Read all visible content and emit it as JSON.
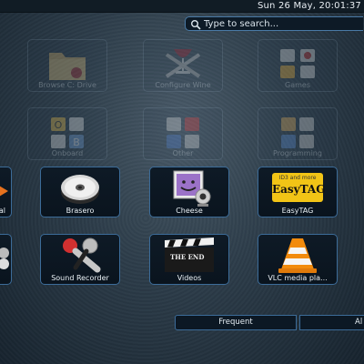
{
  "topbar": {
    "clock": "Sun 26 May, 20:01:37"
  },
  "search": {
    "placeholder": "Type to search..."
  },
  "categories_row1": [
    {
      "label": "Browse C: Drive",
      "icon": "folder-icon"
    },
    {
      "label": "Configure Wine",
      "icon": "wine-config-icon"
    },
    {
      "label": "Games",
      "icon": "games-icon"
    }
  ],
  "categories_row2": [
    {
      "label": "Onboard",
      "icon": "keyboard-icon"
    },
    {
      "label": "Other",
      "icon": "other-apps-icon"
    },
    {
      "label": "Programming",
      "icon": "programming-icon"
    }
  ],
  "apps_row1": [
    {
      "label": "al",
      "icon": "partial-app-icon"
    },
    {
      "label": "Brasero",
      "icon": "disc-burner-icon"
    },
    {
      "label": "Cheese",
      "icon": "webcam-icon"
    },
    {
      "label": "EasyTAG",
      "icon": "easytag-icon",
      "tag_lines": [
        "ID3 and more",
        "EasyTAG"
      ]
    }
  ],
  "apps_row2": [
    {
      "label": "",
      "icon": "partial-app-icon"
    },
    {
      "label": "Sound Recorder",
      "icon": "microphone-icon"
    },
    {
      "label": "Videos",
      "icon": "clapperboard-icon",
      "clap_text": "THE END"
    },
    {
      "label": "VLC media pla...",
      "icon": "vlc-cone-icon"
    }
  ],
  "tabs": {
    "frequent": "Frequent",
    "all": "Al"
  },
  "colors": {
    "accent": "#3c6c99",
    "panel": "#0e1a26"
  }
}
